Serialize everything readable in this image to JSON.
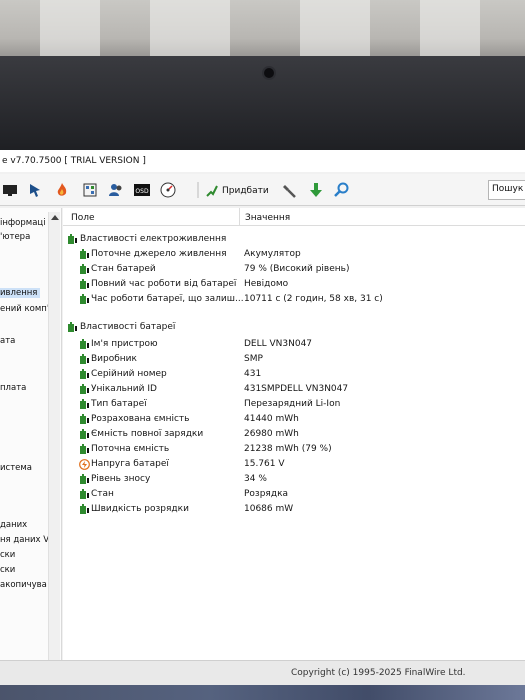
{
  "window": {
    "title": "e v7.70.7500  [ TRIAL VERSION ]"
  },
  "toolbar": {
    "report_label": "Придбати",
    "search_label": "Пошук",
    "icons": [
      "monitor-icon",
      "pointer-icon",
      "flame-icon",
      "network-icon",
      "users-icon",
      "osd-icon",
      "gauge-icon",
      "separator",
      "report-icon",
      "tools-icon",
      "download-icon",
      "search-icon"
    ]
  },
  "sidebar": {
    "items": [
      {
        "label": "інформаці"
      },
      {
        "label": "'ютера"
      },
      {
        "label": "ивлення"
      },
      {
        "label": "ений комп'ю"
      },
      {
        "label": "ата"
      },
      {
        "label": "плата"
      },
      {
        "label": "истема"
      },
      {
        "label": "даних"
      },
      {
        "label": "ня даних V"
      },
      {
        "label": "ски"
      },
      {
        "label": "ски"
      },
      {
        "label": "акопичува"
      }
    ]
  },
  "table": {
    "col_field": "Поле",
    "col_value": "Значення",
    "section1": "Властивості електроживлення",
    "power_rows": [
      {
        "field": "Поточне джерело живлення",
        "value": "Акумулятор"
      },
      {
        "field": "Стан батарей",
        "value": "79 % (Високий рівень)"
      },
      {
        "field": "Повний час роботи від батареї",
        "value": "Невідомо"
      },
      {
        "field": "Час роботи батареї, що залиш...",
        "value": "10711 с (2 годин, 58 хв, 31 с)"
      }
    ],
    "section2": "Властивості батареї",
    "battery_rows": [
      {
        "field": "Ім'я пристрою",
        "value": "DELL VN3N047"
      },
      {
        "field": "Виробник",
        "value": "SMP"
      },
      {
        "field": "Серійний номер",
        "value": "431"
      },
      {
        "field": "Унікальний ID",
        "value": "431SMPDELL VN3N047"
      },
      {
        "field": "Тип батареї",
        "value": "Перезарядний Li-Ion"
      },
      {
        "field": "Розрахована ємність",
        "value": "41440 mWh"
      },
      {
        "field": "Ємність повної зарядки",
        "value": "26980 mWh"
      },
      {
        "field": "Поточна ємність",
        "value": "21238 mWh  (79 %)"
      },
      {
        "field": "Напруга батареї",
        "value": "15.761 V"
      },
      {
        "field": "Рівень зносу",
        "value": "34 %"
      },
      {
        "field": "Стан",
        "value": "Розрядка"
      },
      {
        "field": "Швидкість розрядки",
        "value": "10686 mW"
      }
    ]
  },
  "status": {
    "copyright": "Copyright (c) 1995-2025 FinalWire Ltd."
  },
  "colors": {
    "battery_green": "#2f8a2f",
    "selection": "#cde1f7",
    "voltage_orange": "#e0701e"
  }
}
